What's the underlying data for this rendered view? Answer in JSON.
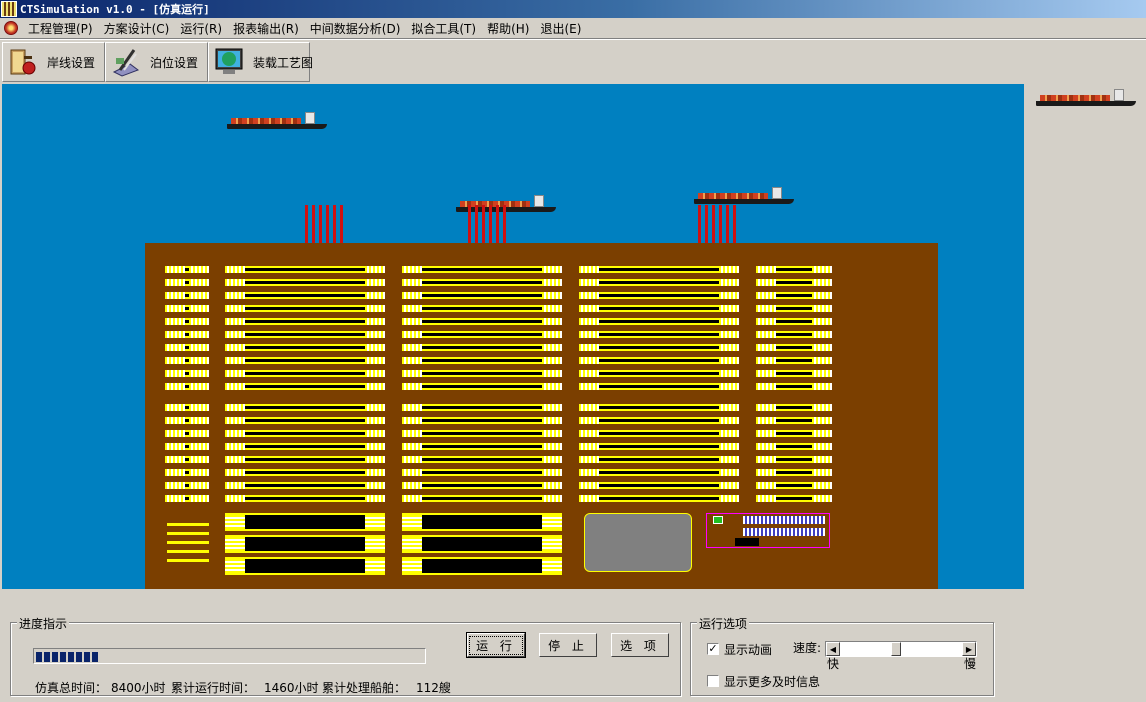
{
  "window": {
    "title": "CTSimulation v1.0 - [仿真运行]"
  },
  "menu": [
    "工程管理(P)",
    "方案设计(C)",
    "运行(R)",
    "报表输出(R)",
    "中间数据分析(D)",
    "拟合工具(T)",
    "帮助(H)",
    "退出(E)"
  ],
  "toolbar": {
    "shoreline_label": "岸线设置",
    "berth_label": "泊位设置",
    "loading_label": "装载工艺图"
  },
  "progress": {
    "legend": "进度指示",
    "fraction": 0.1738,
    "total_time_label": "仿真总时间：",
    "total_time_value": "8400小时",
    "elapsed_label": "累计运行时间：",
    "elapsed_value": "1460小时",
    "ships_label": "累计处理船舶：",
    "ships_value": "112艘",
    "run_label": "运 行",
    "stop_label": "停 止",
    "options_label": "选 项"
  },
  "run_options": {
    "legend": "运行选项",
    "show_animation_label": "显示动画",
    "show_animation_checked": true,
    "speed_label": "速度:",
    "speed_fast_label": "快",
    "speed_slow_label": "慢",
    "speed_level": 0.45,
    "more_info_label": "显示更多及时信息",
    "more_info_checked": false
  },
  "colors": {
    "sea": "#0080c0",
    "yard": "#7b3f00",
    "lane_highlight": "#ffff00",
    "crane": "#d01010",
    "progress": "#0a246a"
  }
}
